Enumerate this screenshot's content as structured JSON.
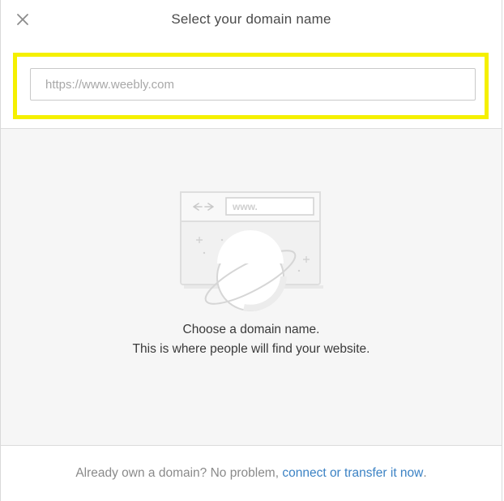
{
  "dialog": {
    "title": "Select your domain name",
    "close_icon": "close-icon"
  },
  "search": {
    "placeholder": "https://www.weebly.com",
    "value": ""
  },
  "empty_state": {
    "illustration_text": "www.",
    "line1": "Choose a domain name.",
    "line2": "This is where people will find your website."
  },
  "footer": {
    "prefix": "Already own a domain? No problem, ",
    "link_label": "connect or transfer it now",
    "suffix": "."
  },
  "colors": {
    "highlight": "#f5f000",
    "link": "#3b82c4",
    "empty_bg": "#f6f6f6"
  }
}
